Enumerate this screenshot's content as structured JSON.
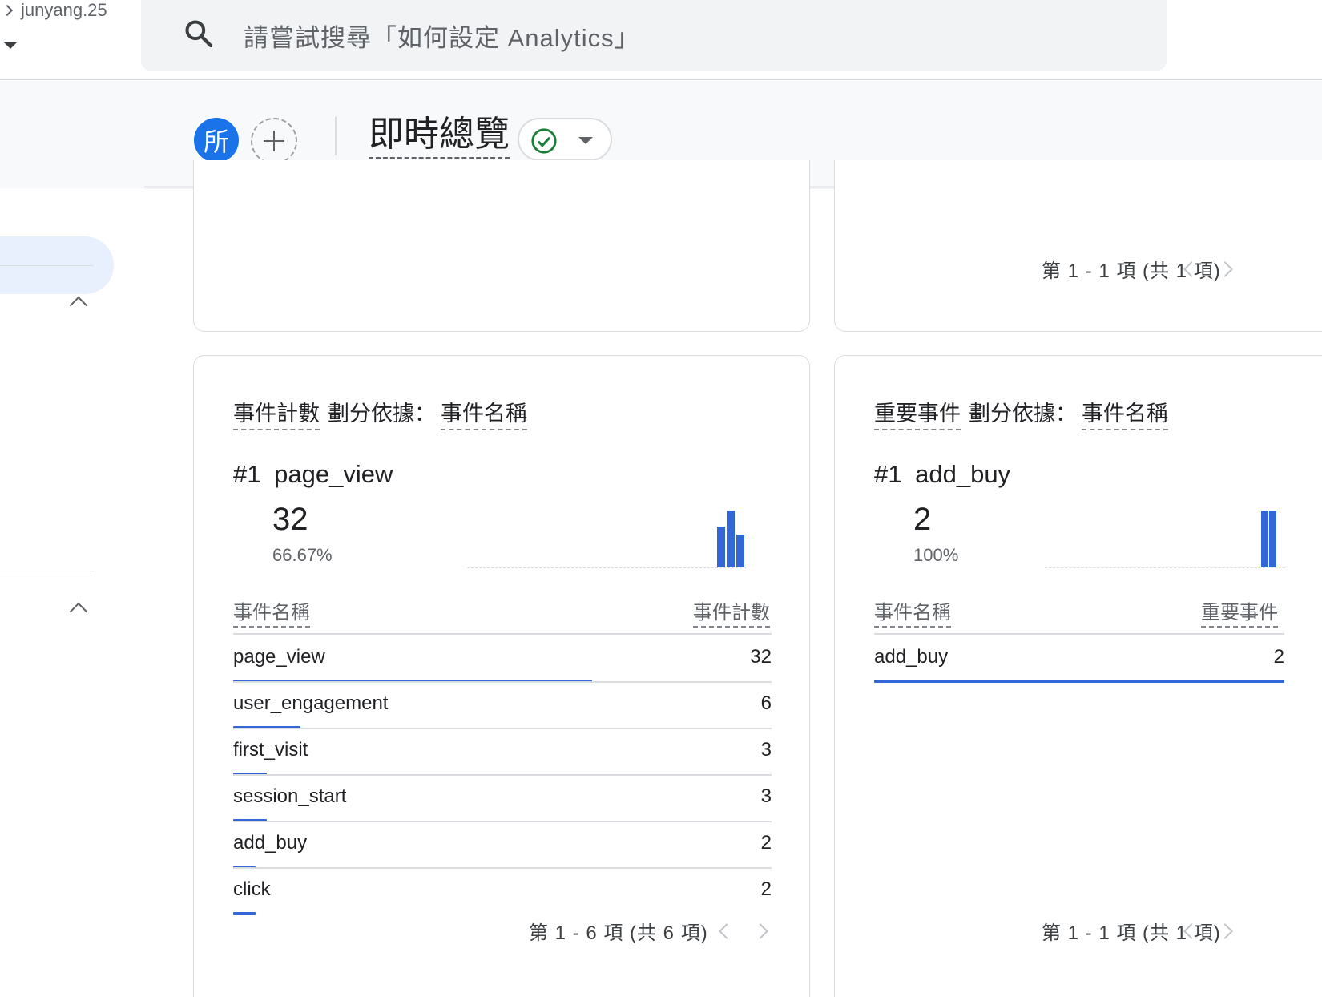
{
  "account": {
    "name": "junyang.25"
  },
  "search": {
    "placeholder": "請嘗試搜尋「如何設定 Analytics」"
  },
  "header": {
    "avatar_label": "所",
    "title": "即時總覽"
  },
  "top_right_card": {
    "pager": "第 1 - 1 項 (共 1 項)"
  },
  "event_count_card": {
    "heading_metric": "事件計數",
    "heading_by": "劃分依據：",
    "heading_dimension": "事件名稱",
    "top_rank": "#1",
    "top_name": "page_view",
    "top_value": "32",
    "top_percent": "66.67%",
    "spark_values": [
      0,
      0,
      0,
      0,
      0,
      0,
      0,
      0,
      0,
      0,
      0,
      0,
      0,
      0,
      0,
      0,
      0,
      0,
      0,
      0,
      0,
      0,
      0,
      0,
      0,
      0,
      15,
      21,
      12
    ],
    "col_name": "事件名稱",
    "col_value": "事件計數",
    "rows": [
      {
        "name": "page_view",
        "value": "32",
        "share": 0.6667
      },
      {
        "name": "user_engagement",
        "value": "6",
        "share": 0.125
      },
      {
        "name": "first_visit",
        "value": "3",
        "share": 0.0625
      },
      {
        "name": "session_start",
        "value": "3",
        "share": 0.0625
      },
      {
        "name": "add_buy",
        "value": "2",
        "share": 0.0417
      },
      {
        "name": "click",
        "value": "2",
        "share": 0.0417
      }
    ],
    "pager": "第 1 - 6 項 (共 6 項)"
  },
  "key_events_card": {
    "heading_metric": "重要事件",
    "heading_by": "劃分依據：",
    "heading_dimension": "事件名稱",
    "top_rank": "#1",
    "top_name": "add_buy",
    "top_value": "2",
    "top_percent": "100%",
    "spark_values": [
      0,
      0,
      0,
      0,
      0,
      0,
      0,
      0,
      0,
      0,
      0,
      0,
      0,
      0,
      0,
      0,
      0,
      0,
      0,
      0,
      0,
      0,
      0,
      0,
      0,
      0,
      0,
      1,
      1,
      0
    ],
    "col_name": "事件名稱",
    "col_value": "重要事件",
    "rows": [
      {
        "name": "add_buy",
        "value": "2",
        "share": 1.0
      }
    ],
    "pager": "第 1 - 1 項 (共 1 項)"
  },
  "colors": {
    "accent": "#1a73e8",
    "bar": "#3367d6",
    "status_ok": "#188038"
  }
}
